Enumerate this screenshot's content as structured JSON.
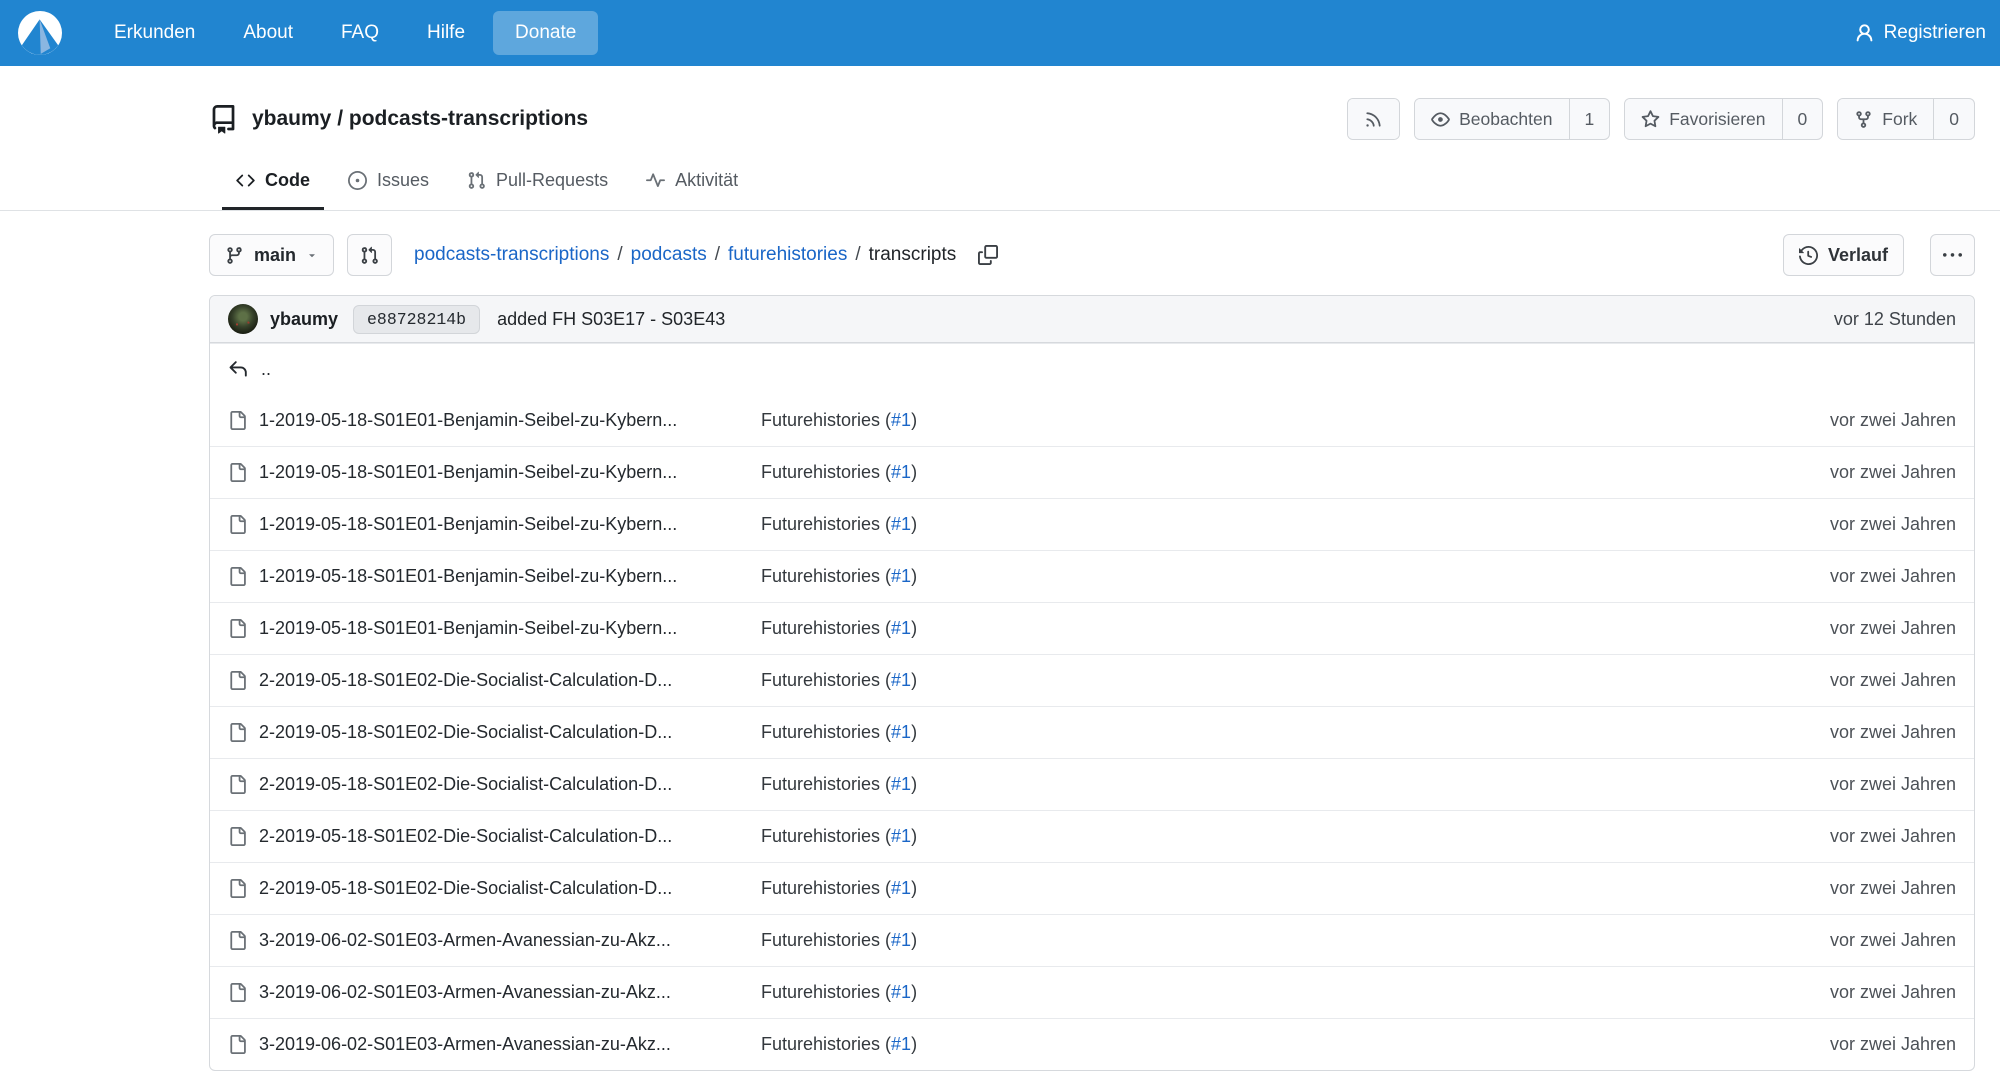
{
  "colors": {
    "nav_blue": "#2185d0",
    "link_blue": "#1a66c7"
  },
  "nav": {
    "items": [
      {
        "label": "Erkunden"
      },
      {
        "label": "About"
      },
      {
        "label": "FAQ"
      },
      {
        "label": "Hilfe"
      }
    ],
    "donate_label": "Donate",
    "register_label": "Registrieren"
  },
  "repo": {
    "title": "ybaumy / podcasts-transcriptions",
    "actions": {
      "watch": {
        "label": "Beobachten",
        "count": "1"
      },
      "star": {
        "label": "Favorisieren",
        "count": "0"
      },
      "fork": {
        "label": "Fork",
        "count": "0"
      }
    }
  },
  "tabs": [
    {
      "label": "Code"
    },
    {
      "label": "Issues"
    },
    {
      "label": "Pull-Requests"
    },
    {
      "label": "Aktivität"
    }
  ],
  "branch_bar": {
    "branch": "main",
    "breadcrumb": {
      "links": [
        "podcasts-transcriptions",
        "podcasts",
        "futurehistories"
      ],
      "separator": "/",
      "current": "transcripts"
    },
    "history_label": "Verlauf"
  },
  "commit": {
    "author": "ybaumy",
    "hash": "e88728214b",
    "message": "added FH S03E17 - S03E43",
    "date": "vor 12 Stunden"
  },
  "file_list": {
    "parent_label": "..",
    "rows": [
      {
        "name": "1-2019-05-18-S01E01-Benjamin-Seibel-zu-Kybern...",
        "commit_text": "Futurehistories (",
        "issue_link": "#1",
        "commit_text_end": ")",
        "date": "vor zwei Jahren"
      },
      {
        "name": "1-2019-05-18-S01E01-Benjamin-Seibel-zu-Kybern...",
        "commit_text": "Futurehistories (",
        "issue_link": "#1",
        "commit_text_end": ")",
        "date": "vor zwei Jahren"
      },
      {
        "name": "1-2019-05-18-S01E01-Benjamin-Seibel-zu-Kybern...",
        "commit_text": "Futurehistories (",
        "issue_link": "#1",
        "commit_text_end": ")",
        "date": "vor zwei Jahren"
      },
      {
        "name": "1-2019-05-18-S01E01-Benjamin-Seibel-zu-Kybern...",
        "commit_text": "Futurehistories (",
        "issue_link": "#1",
        "commit_text_end": ")",
        "date": "vor zwei Jahren"
      },
      {
        "name": "1-2019-05-18-S01E01-Benjamin-Seibel-zu-Kybern...",
        "commit_text": "Futurehistories (",
        "issue_link": "#1",
        "commit_text_end": ")",
        "date": "vor zwei Jahren"
      },
      {
        "name": "2-2019-05-18-S01E02-Die-Socialist-Calculation-D...",
        "commit_text": "Futurehistories (",
        "issue_link": "#1",
        "commit_text_end": ")",
        "date": "vor zwei Jahren"
      },
      {
        "name": "2-2019-05-18-S01E02-Die-Socialist-Calculation-D...",
        "commit_text": "Futurehistories (",
        "issue_link": "#1",
        "commit_text_end": ")",
        "date": "vor zwei Jahren"
      },
      {
        "name": "2-2019-05-18-S01E02-Die-Socialist-Calculation-D...",
        "commit_text": "Futurehistories (",
        "issue_link": "#1",
        "commit_text_end": ")",
        "date": "vor zwei Jahren"
      },
      {
        "name": "2-2019-05-18-S01E02-Die-Socialist-Calculation-D...",
        "commit_text": "Futurehistories (",
        "issue_link": "#1",
        "commit_text_end": ")",
        "date": "vor zwei Jahren"
      },
      {
        "name": "2-2019-05-18-S01E02-Die-Socialist-Calculation-D...",
        "commit_text": "Futurehistories (",
        "issue_link": "#1",
        "commit_text_end": ")",
        "date": "vor zwei Jahren"
      },
      {
        "name": "3-2019-06-02-S01E03-Armen-Avanessian-zu-Akz...",
        "commit_text": "Futurehistories (",
        "issue_link": "#1",
        "commit_text_end": ")",
        "date": "vor zwei Jahren"
      },
      {
        "name": "3-2019-06-02-S01E03-Armen-Avanessian-zu-Akz...",
        "commit_text": "Futurehistories (",
        "issue_link": "#1",
        "commit_text_end": ")",
        "date": "vor zwei Jahren"
      },
      {
        "name": "3-2019-06-02-S01E03-Armen-Avanessian-zu-Akz...",
        "commit_text": "Futurehistories (",
        "issue_link": "#1",
        "commit_text_end": ")",
        "date": "vor zwei Jahren"
      }
    ]
  }
}
